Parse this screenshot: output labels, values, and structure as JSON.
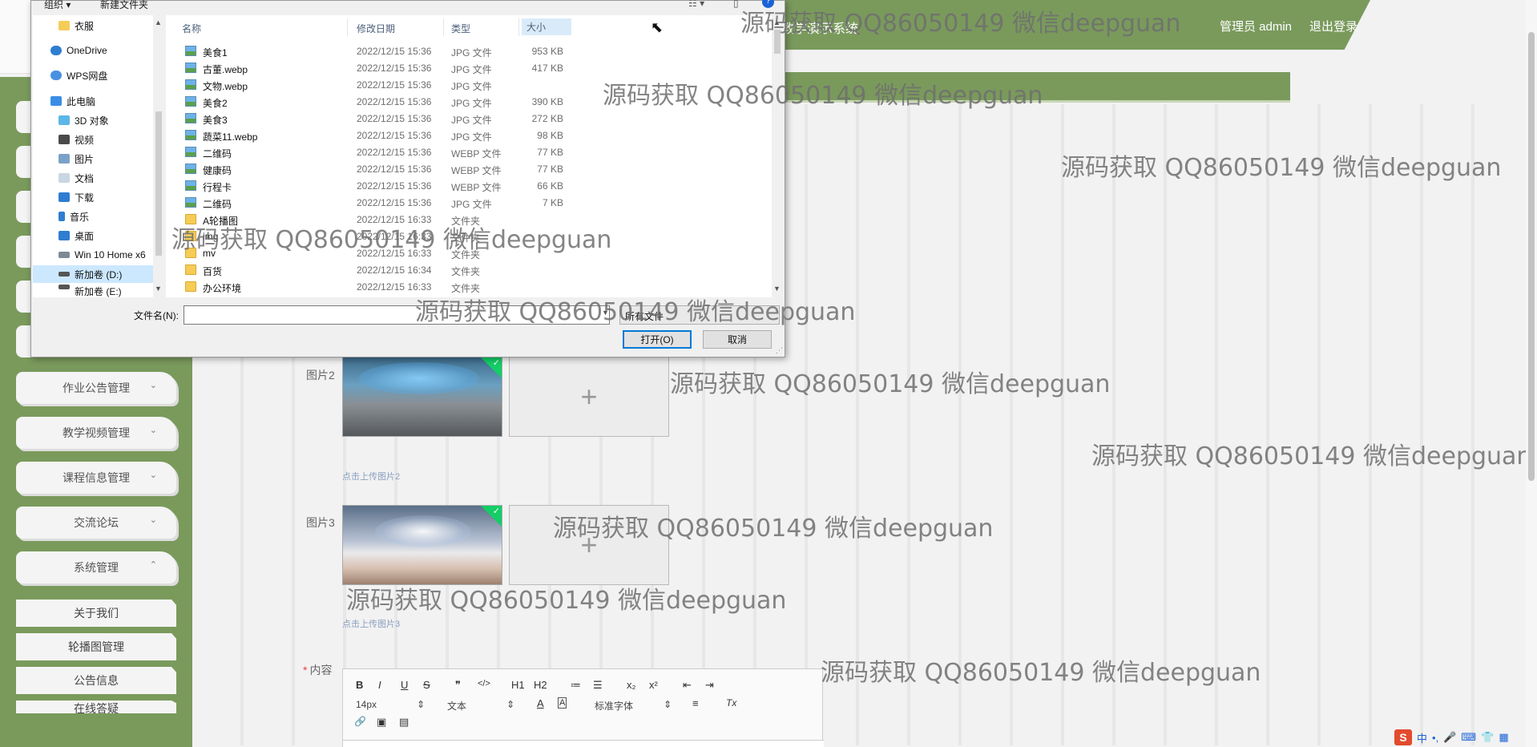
{
  "header": {
    "system_title": "教学演示系统",
    "admin": "管理员 admin",
    "logout": "退出登录"
  },
  "sidebar": {
    "menus": [
      {
        "label": "作业公告管理",
        "chevron": "chevron-down"
      },
      {
        "label": "教学视频管理",
        "chevron": "chevron-down"
      },
      {
        "label": "课程信息管理",
        "chevron": "chevron-down"
      },
      {
        "label": "交流论坛",
        "chevron": "chevron-down"
      },
      {
        "label": "系统管理",
        "chevron": "chevron-up"
      }
    ],
    "submenu": [
      {
        "label": "关于我们"
      },
      {
        "label": "轮播图管理"
      },
      {
        "label": "公告信息"
      },
      {
        "label": "在线答疑"
      }
    ]
  },
  "form": {
    "pic2_label": "图片2",
    "pic2_hint": "点击上传图片2",
    "pic3_label": "图片3",
    "pic3_hint": "点击上传图片3",
    "content_label": "内容",
    "required_mark": "*",
    "plus": "+"
  },
  "editor": {
    "buttons": [
      "B",
      "I",
      "U",
      "S",
      "❞",
      "</>",
      "H1",
      "H2",
      "≔",
      "☰",
      "x₂",
      "x²",
      "⇤",
      "⇥"
    ],
    "font_size": "14px",
    "heading": "文本",
    "font": "标准字体",
    "font_color_icon": "A",
    "bg_color_icon": "A",
    "align_icon": "≡",
    "clear_icon": "Tx",
    "link_icon": "🔗",
    "image_icon": "▣",
    "video_icon": "▤"
  },
  "dialog": {
    "organize": "组织 ▾",
    "new_folder": "新建文件夹",
    "nav": [
      {
        "label": "衣服",
        "icon": "folder"
      },
      {
        "label": "OneDrive",
        "icon": "cloud"
      },
      {
        "label": "WPS网盘",
        "icon": "cloud"
      },
      {
        "label": "此电脑",
        "icon": "pc"
      },
      {
        "label": "3D 对象",
        "icon": "cube"
      },
      {
        "label": "视频",
        "icon": "video"
      },
      {
        "label": "图片",
        "icon": "picture"
      },
      {
        "label": "文档",
        "icon": "document"
      },
      {
        "label": "下载",
        "icon": "download"
      },
      {
        "label": "音乐",
        "icon": "music"
      },
      {
        "label": "桌面",
        "icon": "desktop"
      },
      {
        "label": "Win 10 Home x6",
        "icon": "drive"
      },
      {
        "label": "新加卷 (D:)",
        "icon": "drive"
      },
      {
        "label": "新加卷 (E:)",
        "icon": "drive"
      }
    ],
    "columns": {
      "name": "名称",
      "date": "修改日期",
      "type": "类型",
      "size": "大小"
    },
    "files": [
      {
        "name": "美食1",
        "date": "2022/12/15 15:36",
        "type": "JPG 文件",
        "size": "953 KB",
        "kind": "img"
      },
      {
        "name": "古董.webp",
        "date": "2022/12/15 15:36",
        "type": "JPG 文件",
        "size": "417 KB",
        "kind": "img"
      },
      {
        "name": "文物.webp",
        "date": "2022/12/15 15:36",
        "type": "JPG 文件",
        "size": "",
        "kind": "img"
      },
      {
        "name": "美食2",
        "date": "2022/12/15 15:36",
        "type": "JPG 文件",
        "size": "390 KB",
        "kind": "img"
      },
      {
        "name": "美食3",
        "date": "2022/12/15 15:36",
        "type": "JPG 文件",
        "size": "272 KB",
        "kind": "img"
      },
      {
        "name": "蔬菜11.webp",
        "date": "2022/12/15 15:36",
        "type": "JPG 文件",
        "size": "98 KB",
        "kind": "img"
      },
      {
        "name": "二维码",
        "date": "2022/12/15 15:36",
        "type": "WEBP 文件",
        "size": "77 KB",
        "kind": "img"
      },
      {
        "name": "健康码",
        "date": "2022/12/15 15:36",
        "type": "WEBP 文件",
        "size": "77 KB",
        "kind": "img"
      },
      {
        "name": "行程卡",
        "date": "2022/12/15 15:36",
        "type": "WEBP 文件",
        "size": "66 KB",
        "kind": "img"
      },
      {
        "name": "二维码",
        "date": "2022/12/15 15:36",
        "type": "JPG 文件",
        "size": "7 KB",
        "kind": "img"
      },
      {
        "name": "A轮播图",
        "date": "2022/12/15 16:33",
        "type": "文件夹",
        "size": "",
        "kind": "folder"
      },
      {
        "name": "img",
        "date": "2022/12/15 16:33",
        "type": "文件夹",
        "size": "",
        "kind": "folder"
      },
      {
        "name": "mv",
        "date": "2022/12/15 16:33",
        "type": "文件夹",
        "size": "",
        "kind": "folder"
      },
      {
        "name": "百货",
        "date": "2022/12/15 16:34",
        "type": "文件夹",
        "size": "",
        "kind": "folder"
      },
      {
        "name": "办公环境",
        "date": "2022/12/15 16:33",
        "type": "文件夹",
        "size": "",
        "kind": "folder"
      }
    ],
    "filename_label": "文件名(N):",
    "filename_value": "",
    "filter": "所有文件",
    "open": "打开(O)",
    "cancel": "取消"
  },
  "watermark": "源码获取 QQ86050149 微信deepguan",
  "ime": {
    "lang": "中",
    "dot": "•,"
  },
  "colors": {
    "accent": "#7a9a5c",
    "selected": "#13ce66"
  }
}
